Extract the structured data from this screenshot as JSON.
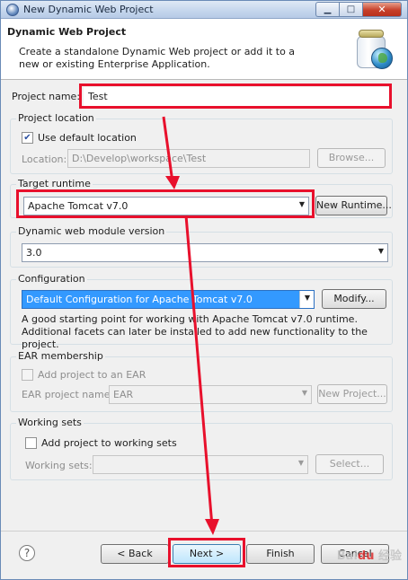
{
  "window": {
    "title": "New Dynamic Web Project"
  },
  "header": {
    "title": "Dynamic Web Project",
    "description": "Create a standalone Dynamic Web project or add it to a new or existing Enterprise Application."
  },
  "project_name": {
    "label": "Project name:",
    "value": "Test"
  },
  "project_location": {
    "group_label": "Project location",
    "use_default_label": "Use default location",
    "use_default_checked": true,
    "location_label": "Location:",
    "location_value": "D:\\Develop\\workspace\\Test",
    "browse_label": "Browse..."
  },
  "target_runtime": {
    "group_label": "Target runtime",
    "value": "Apache Tomcat v7.0",
    "new_runtime_label": "New Runtime..."
  },
  "module_version": {
    "group_label": "Dynamic web module version",
    "value": "3.0"
  },
  "configuration": {
    "group_label": "Configuration",
    "value": "Default Configuration for Apache Tomcat v7.0",
    "modify_label": "Modify...",
    "description": "A good starting point for working with Apache Tomcat v7.0 runtime. Additional facets can later be installed to add new functionality to the project."
  },
  "ear": {
    "group_label": "EAR membership",
    "add_label": "Add project to an EAR",
    "add_checked": false,
    "name_label": "EAR project name:",
    "name_value": "EAR",
    "new_project_label": "New Project..."
  },
  "working_sets": {
    "group_label": "Working sets",
    "add_label": "Add project to working sets",
    "add_checked": false,
    "sets_label": "Working sets:",
    "sets_value": "",
    "select_label": "Select..."
  },
  "buttons": {
    "help": "?",
    "back": "< Back",
    "next": "Next >",
    "finish": "Finish",
    "cancel": "Cancel"
  },
  "watermark": "Baidu 经验",
  "colors": {
    "annotation": "#e8102c",
    "selection": "#3399ff"
  }
}
